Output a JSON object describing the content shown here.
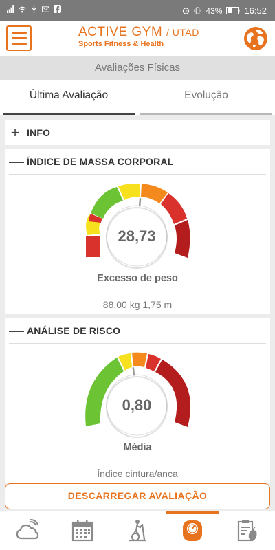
{
  "status_bar": {
    "battery": "43%",
    "time": "16:52"
  },
  "header": {
    "brand_title": "ACTIVE GYM",
    "brand_suffix": "/ UTAD",
    "brand_tagline": "Sports  Fitness & Health"
  },
  "page": {
    "section_title": "Avaliações Físicas"
  },
  "tabs": [
    {
      "label": "Última Avaliação",
      "active": true
    },
    {
      "label": "Evolução",
      "active": false
    }
  ],
  "info_card": {
    "toggle": "+",
    "title": "INFO"
  },
  "imc_card": {
    "toggle": "—",
    "title": "ÍNDICE DE MASSA CORPORAL",
    "value": "28,73",
    "classification": "Excesso de peso",
    "details": "88,00 kg  1,75 m",
    "needle_fraction": 0.52
  },
  "risk_card": {
    "toggle": "—",
    "title": "ANÁLISE DE RISCO",
    "value": "0,80",
    "classification": "Média",
    "details": "Índice cintura/anca",
    "needle_fraction": 0.48
  },
  "download_button": {
    "label": "DESCARREGAR AVALIAÇÃO"
  },
  "bottom_nav": [
    {
      "icon": "weather-cloud-icon",
      "active": false
    },
    {
      "icon": "calendar-icon",
      "active": false
    },
    {
      "icon": "elliptical-trainer-icon",
      "active": false
    },
    {
      "icon": "scale-icon",
      "active": true
    },
    {
      "icon": "clipboard-nutrition-icon",
      "active": false
    }
  ],
  "colors": {
    "accent": "#e8731f",
    "gauge_green": "#6cc435",
    "gauge_yellow": "#f7e01e",
    "gauge_orange": "#f48a1e",
    "gauge_red": "#d9322d",
    "gauge_darkred": "#b31d1d"
  }
}
